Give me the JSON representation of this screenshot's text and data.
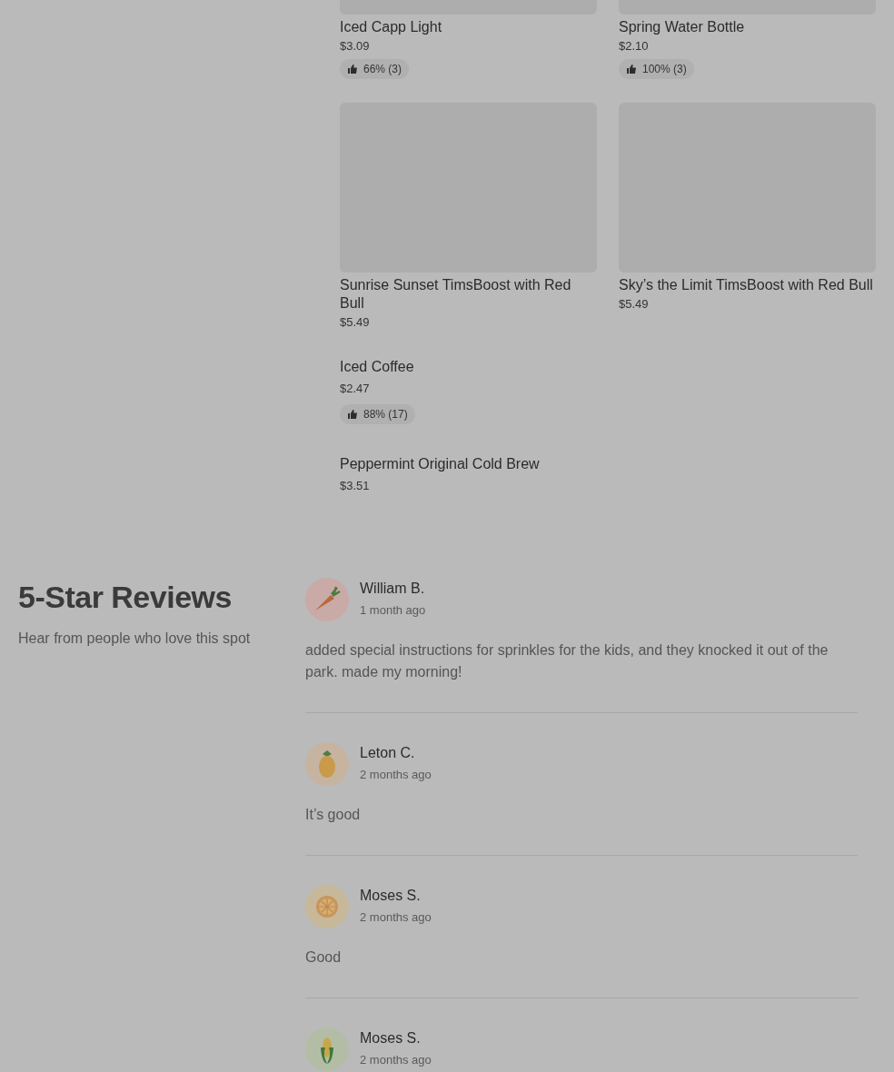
{
  "menu_items": [
    {
      "kind": "cropped",
      "name": "Iced Capp Light",
      "price": "$3.09",
      "rating": "66% (3)"
    },
    {
      "kind": "cropped",
      "name": "Spring Water Bottle",
      "price": "$2.10",
      "rating": "100% (3)"
    },
    {
      "kind": "card",
      "name": "Sunrise Sunset TimsBoost with Red Bull",
      "price": "$5.49"
    },
    {
      "kind": "card",
      "name": "Sky’s the Limit TimsBoost with Red Bull",
      "price": "$5.49"
    },
    {
      "kind": "plain",
      "name": "Iced Coffee",
      "price": "$2.47",
      "rating": "88% (17)"
    },
    {
      "kind": "plain",
      "name": "Peppermint Original Cold Brew",
      "price": "$3.51"
    }
  ],
  "reviews_section": {
    "title": "5-Star Reviews",
    "subtitle": "Hear from people who love this spot",
    "reviews": [
      {
        "kind": "carrot",
        "name": "William B.",
        "time": "1 month ago",
        "text": "added special instructions for sprinkles for the kids, and they knocked it out of the park. made my morning!"
      },
      {
        "kind": "pineapple",
        "name": "Leton C.",
        "time": "2 months ago",
        "text": "It’s good"
      },
      {
        "kind": "orange",
        "name": "Moses S.",
        "time": "2 months ago",
        "text": "Good"
      },
      {
        "kind": "corn",
        "name": "Moses S.",
        "time": "2 months ago"
      }
    ]
  }
}
